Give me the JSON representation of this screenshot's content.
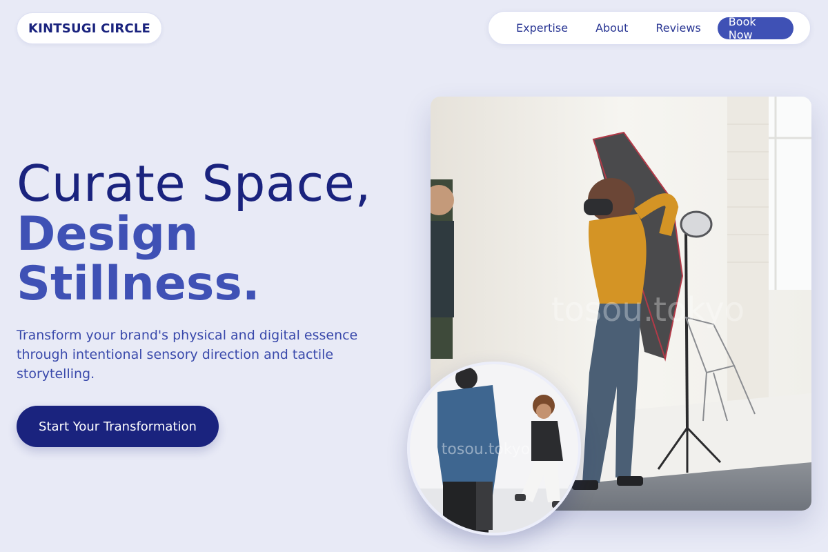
{
  "brand": {
    "name": "KINTSUGI CIRCLE"
  },
  "nav": {
    "links": [
      "Expertise",
      "About",
      "Reviews"
    ],
    "cta": "Book Now"
  },
  "hero": {
    "title_line1": "Curate Space,",
    "title_line2a": "Design",
    "title_line2b": "Stillness.",
    "subtitle": "Transform your brand's physical and digital essence through intentional sensory direction and tactile storytelling.",
    "cta": "Start Your Transformation"
  },
  "images": {
    "main_watermark": "tosou.tokyo",
    "circle_watermark": "tosou.tokyo"
  },
  "colors": {
    "background": "#e8eaf6",
    "primary_dark": "#1a237e",
    "primary": "#3f51b5",
    "text_sub": "#3949ab"
  }
}
